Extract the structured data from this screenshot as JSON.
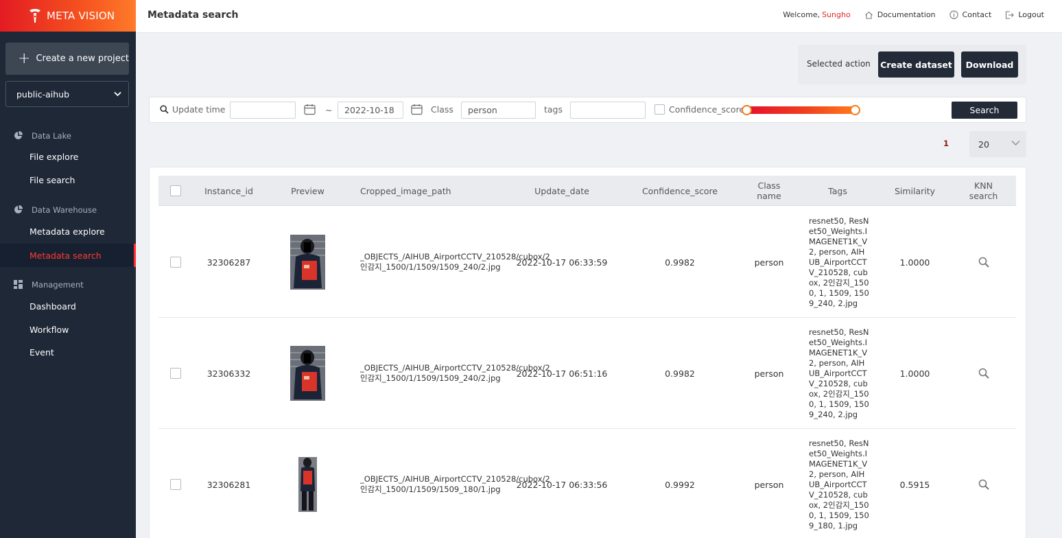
{
  "brand": {
    "name": "META VISION",
    "accent": "#e31b23"
  },
  "sidebar": {
    "create_label": "Create a new project",
    "project": "public-aihub",
    "sections": [
      {
        "title": "Data Lake",
        "icon": "pie-chart-icon",
        "items": [
          "File explore",
          "File search"
        ]
      },
      {
        "title": "Data Warehouse",
        "icon": "pie-chart-icon",
        "items": [
          "Metadata explore",
          "Metadata search"
        ]
      },
      {
        "title": "Management",
        "icon": "dashboard-grid-icon",
        "items": [
          "Dashboard",
          "Workflow",
          "Event"
        ]
      }
    ],
    "active_item": "Metadata search"
  },
  "header": {
    "title": "Metadata search",
    "welcome": "Welcome,",
    "user": "Sungho",
    "links": [
      "Documentation",
      "Contact",
      "Logout"
    ]
  },
  "actions": {
    "label": "Selected action",
    "create_dataset": "Create dataset",
    "download": "Download"
  },
  "filters": {
    "update_time_label": "Update time",
    "date_from": "",
    "date_sep": "~",
    "date_to": "2022-10-18",
    "class_label": "Class",
    "class_value": "person",
    "tags_label": "tags",
    "tags_value": "",
    "confidence_label": "Confidence_score",
    "confidence_checked": false,
    "confidence_range": [
      0.0,
      1.0
    ],
    "search_label": "Search"
  },
  "pagination": {
    "current_page": "1",
    "per_page": "20"
  },
  "table": {
    "columns": [
      "Instance_id",
      "Preview",
      "Cropped_image_path",
      "Update_date",
      "Confidence_score",
      "Class name",
      "Tags",
      "Similarity",
      "KNN search"
    ],
    "rows": [
      {
        "instance_id": "32306287",
        "path": "_OBJECTS_/AIHUB_AirportCCTV_210528/cubox/2인감지_1500/1/1509/1509_240/2.jpg",
        "update_date": "2022-10-17 06:33:59",
        "confidence": "0.9982",
        "class_name": "person",
        "tags": "resnet50, ResNet50_Weights.IMAGENET1K_V2, person, AIHUB_AirportCCTV_210528, cubox, 2인감지_1500, 1, 1509, 1509_240, 2.jpg",
        "similarity": "1.0000"
      },
      {
        "instance_id": "32306332",
        "path": "_OBJECTS_/AIHUB_AirportCCTV_210528/cubox/2인감지_1500/1/1509/1509_240/2.jpg",
        "update_date": "2022-10-17 06:51:16",
        "confidence": "0.9982",
        "class_name": "person",
        "tags": "resnet50, ResNet50_Weights.IMAGENET1K_V2, person, AIHUB_AirportCCTV_210528, cubox, 2인감지_1500, 1, 1509, 1509_240, 2.jpg",
        "similarity": "1.0000"
      },
      {
        "instance_id": "32306281",
        "path": "_OBJECTS_/AIHUB_AirportCCTV_210528/cubox/2인감지_1500/1/1509/1509_180/1.jpg",
        "update_date": "2022-10-17 06:33:56",
        "confidence": "0.9992",
        "class_name": "person",
        "tags": "resnet50, ResNet50_Weights.IMAGENET1K_V2, person, AIHUB_AirportCCTV_210528, cubox, 2인감지_1500, 1, 1509, 1509_180, 1.jpg",
        "similarity": "0.5915"
      }
    ]
  }
}
